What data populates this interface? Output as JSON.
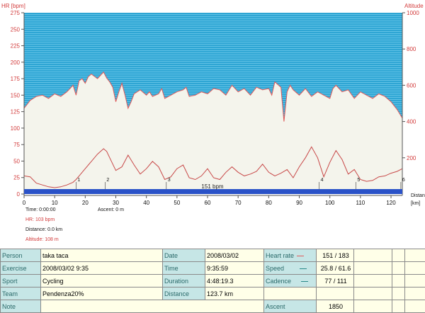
{
  "chart_data": {
    "type": "line",
    "y_left_label": "HR [bpm]",
    "y_right_label": "Altitude [m]",
    "x_label_lines": [
      "Distance",
      "[km]"
    ],
    "x_range": [
      0,
      123.7
    ],
    "x_ticks": [
      "0",
      "10",
      "20",
      "30",
      "40",
      "50",
      "60",
      "70",
      "80",
      "90",
      "100",
      "110",
      "120"
    ],
    "y_left_range": [
      0,
      275
    ],
    "y_left_ticks": [
      "0",
      "25",
      "50",
      "75",
      "100",
      "125",
      "150",
      "175",
      "200",
      "225",
      "250",
      "275"
    ],
    "y_right_range": [
      0,
      1000
    ],
    "y_right_ticks": [
      "200",
      "400",
      "600",
      "800",
      "1000"
    ],
    "grid": false,
    "bottom_bar_label": "151 bpm",
    "lap_markers": [
      {
        "label": "1",
        "x": 17.0
      },
      {
        "label": "2",
        "x": 26.5
      },
      {
        "label": "3",
        "x": 46.5
      },
      {
        "label": "4",
        "x": 96.5
      },
      {
        "label": "5",
        "x": 108.5
      },
      {
        "label": "6",
        "x": 123.2
      }
    ],
    "series": [
      {
        "name": "HR",
        "color": "#e05a5a",
        "x": [
          0,
          2,
          4,
          6,
          8,
          10,
          12,
          14,
          15,
          16,
          17,
          18,
          19,
          20,
          21,
          22,
          24,
          25,
          26,
          27,
          28,
          29,
          30,
          31,
          32,
          33,
          34,
          35,
          36,
          38,
          40,
          41,
          42,
          44,
          45,
          46,
          48,
          50,
          52,
          53,
          54,
          56,
          58,
          60,
          62,
          64,
          66,
          68,
          70,
          72,
          74,
          76,
          78,
          80,
          81,
          82,
          84,
          85,
          86,
          87,
          88,
          90,
          92,
          94,
          96,
          98,
          100,
          101,
          102,
          104,
          106,
          108,
          110,
          112,
          114,
          116,
          118,
          120,
          122,
          123.7
        ],
        "y": [
          130,
          142,
          148,
          150,
          145,
          152,
          148,
          155,
          160,
          165,
          150,
          172,
          175,
          168,
          178,
          182,
          175,
          180,
          185,
          176,
          170,
          162,
          140,
          155,
          168,
          150,
          130,
          140,
          152,
          158,
          150,
          155,
          148,
          152,
          160,
          145,
          150,
          155,
          158,
          162,
          148,
          150,
          155,
          152,
          160,
          158,
          150,
          165,
          155,
          160,
          150,
          162,
          158,
          160,
          150,
          170,
          162,
          110,
          155,
          165,
          158,
          150,
          160,
          148,
          155,
          150,
          145,
          160,
          165,
          155,
          158,
          145,
          155,
          150,
          145,
          152,
          148,
          140,
          128,
          115
        ]
      },
      {
        "name": "Altitude",
        "color": "#c84848",
        "x": [
          0,
          2,
          4,
          6,
          8,
          10,
          12,
          14,
          16,
          17,
          18,
          20,
          22,
          24,
          26,
          27,
          28,
          30,
          32,
          34,
          36,
          38,
          40,
          42,
          44,
          46,
          48,
          50,
          52,
          54,
          56,
          58,
          60,
          62,
          64,
          66,
          68,
          70,
          72,
          74,
          76,
          78,
          80,
          82,
          84,
          86,
          88,
          90,
          92,
          94,
          96,
          98,
          100,
          102,
          104,
          106,
          108,
          110,
          112,
          114,
          116,
          118,
          120,
          122,
          123.7
        ],
        "y": [
          100,
          95,
          60,
          50,
          40,
          35,
          40,
          50,
          65,
          80,
          100,
          140,
          180,
          220,
          250,
          235,
          200,
          130,
          150,
          215,
          160,
          110,
          140,
          180,
          150,
          80,
          95,
          140,
          160,
          90,
          80,
          100,
          140,
          90,
          80,
          120,
          150,
          120,
          100,
          110,
          125,
          165,
          120,
          100,
          115,
          135,
          90,
          150,
          200,
          260,
          200,
          95,
          175,
          240,
          190,
          110,
          135,
          80,
          70,
          75,
          95,
          100,
          115,
          125,
          140
        ]
      }
    ]
  },
  "info": {
    "time": "Time: 0:00:00",
    "ascent": "Ascent: 0 m",
    "hr": "HR: 103 bpm",
    "distance": "Distance: 0.0 km",
    "altitude": "Altitude: 108 m"
  },
  "summary": {
    "person_label": "Person",
    "person_value": "taka taca",
    "exercise_label": "Exercise",
    "exercise_value": "2008/03/02 9:35",
    "sport_label": "Sport",
    "sport_value": "Cycling",
    "team_label": "Team",
    "team_value": "Pendenza20%",
    "note_label": "Note",
    "date_label": "Date",
    "date_value": "2008/03/02",
    "time_label": "Time",
    "time_value": "9:35:59",
    "duration_label": "Duration",
    "duration_value": "4:48:19.3",
    "distance_label": "Distance",
    "distance_value": "123.7 km",
    "hr_label": "Heart rate",
    "hr_value": "151 / 183",
    "hr_color": "#e05a5a",
    "speed_label": "Speed",
    "speed_value": "25.8 / 61.6",
    "speed_color": "#2a8a8a",
    "cadence_label": "Cadence",
    "cadence_value": "77 / 111",
    "cadence_color": "#2a8a8a",
    "ascent_label": "Ascent",
    "ascent_value": "1850"
  }
}
